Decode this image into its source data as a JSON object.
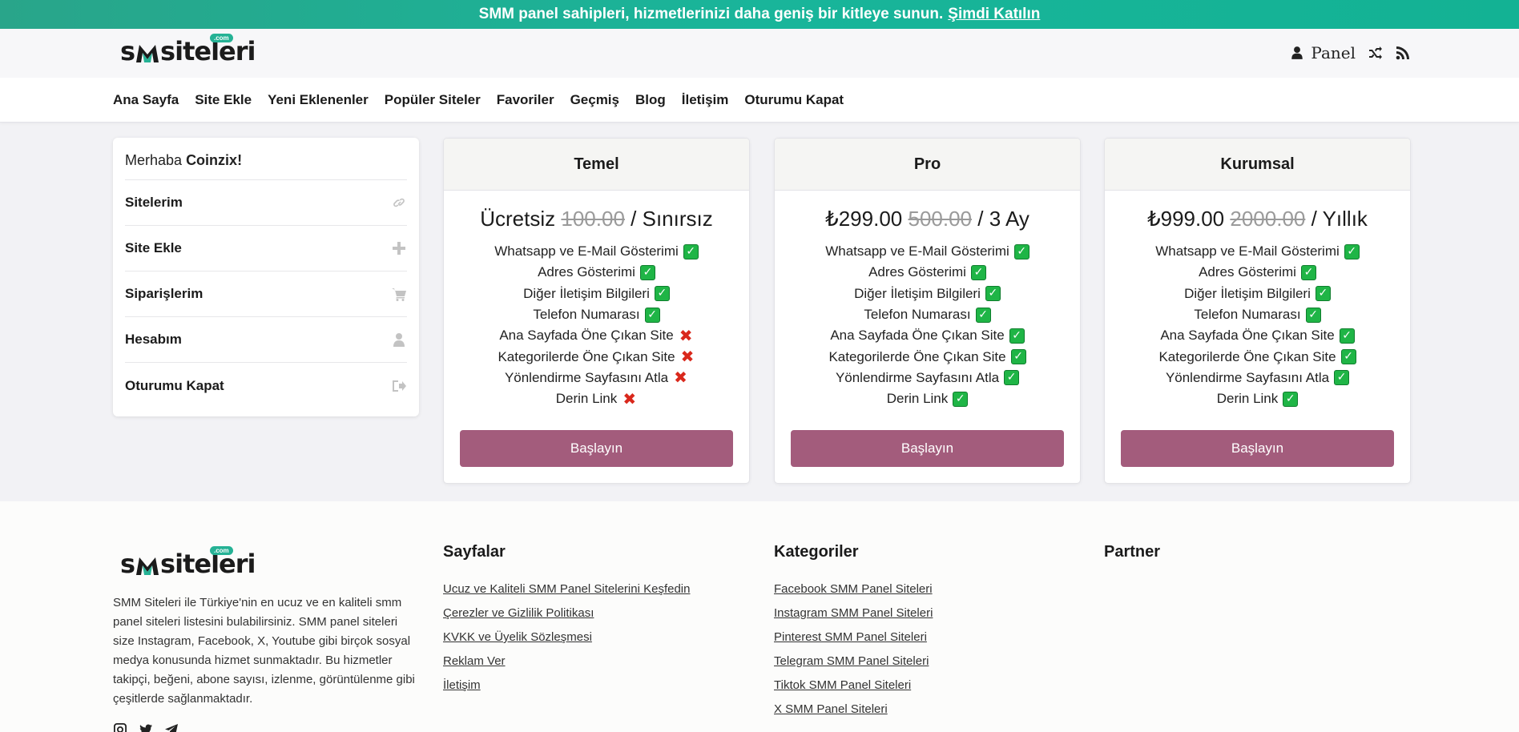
{
  "promo": {
    "text": "SMM panel sahipleri, hizmetlerinizi daha geniş bir kitleye sunun.",
    "link": "Şimdi Katılın"
  },
  "brand": {
    "logo_left": "s",
    "logo_right": "siteleri",
    "logo_tag": ".com"
  },
  "header": {
    "panel_label": "Panel"
  },
  "nav": {
    "items": [
      "Ana Sayfa",
      "Site Ekle",
      "Yeni Eklenenler",
      "Popüler Siteler",
      "Favoriler",
      "Geçmiş",
      "Blog",
      "İletişim",
      "Oturumu Kapat"
    ]
  },
  "sidebar": {
    "greeting": "Merhaba",
    "username": "Coinzix!",
    "items": [
      {
        "label": "Sitelerim",
        "icon": "link-icon"
      },
      {
        "label": "Site Ekle",
        "icon": "plus-icon"
      },
      {
        "label": "Siparişlerim",
        "icon": "cart-icon"
      },
      {
        "label": "Hesabım",
        "icon": "user-icon"
      },
      {
        "label": "Oturumu Kapat",
        "icon": "sign-out-icon"
      }
    ]
  },
  "plans": [
    {
      "name": "Temel",
      "price": "Ücretsiz",
      "old_price": "100.00",
      "period": "/ Sınırsız",
      "button": "Başlayın",
      "features": [
        {
          "label": "Whatsapp ve E-Mail Gösterimi",
          "included": true
        },
        {
          "label": "Adres Gösterimi",
          "included": true
        },
        {
          "label": "Diğer İletişim Bilgileri",
          "included": true
        },
        {
          "label": "Telefon Numarası",
          "included": true
        },
        {
          "label": "Ana Sayfada Öne Çıkan Site",
          "included": false
        },
        {
          "label": "Kategorilerde Öne Çıkan Site",
          "included": false
        },
        {
          "label": "Yönlendirme Sayfasını Atla",
          "included": false
        },
        {
          "label": "Derin Link",
          "included": false
        }
      ]
    },
    {
      "name": "Pro",
      "price": "₺299.00",
      "old_price": "500.00",
      "period": "/ 3 Ay",
      "button": "Başlayın",
      "features": [
        {
          "label": "Whatsapp ve E-Mail Gösterimi",
          "included": true
        },
        {
          "label": "Adres Gösterimi",
          "included": true
        },
        {
          "label": "Diğer İletişim Bilgileri",
          "included": true
        },
        {
          "label": "Telefon Numarası",
          "included": true
        },
        {
          "label": "Ana Sayfada Öne Çıkan Site",
          "included": true
        },
        {
          "label": "Kategorilerde Öne Çıkan Site",
          "included": true
        },
        {
          "label": "Yönlendirme Sayfasını Atla",
          "included": true
        },
        {
          "label": "Derin Link",
          "included": true
        }
      ]
    },
    {
      "name": "Kurumsal",
      "price": "₺999.00",
      "old_price": "2000.00",
      "period": "/ Yıllık",
      "button": "Başlayın",
      "features": [
        {
          "label": "Whatsapp ve E-Mail Gösterimi",
          "included": true
        },
        {
          "label": "Adres Gösterimi",
          "included": true
        },
        {
          "label": "Diğer İletişim Bilgileri",
          "included": true
        },
        {
          "label": "Telefon Numarası",
          "included": true
        },
        {
          "label": "Ana Sayfada Öne Çıkan Site",
          "included": true
        },
        {
          "label": "Kategorilerde Öne Çıkan Site",
          "included": true
        },
        {
          "label": "Yönlendirme Sayfasını Atla",
          "included": true
        },
        {
          "label": "Derin Link",
          "included": true
        }
      ]
    }
  ],
  "footer": {
    "about": "SMM Siteleri ile Türkiye'nin en ucuz ve en kaliteli smm panel siteleri listesini bulabilirsiniz. SMM panel siteleri size Instagram, Facebook, X, Youtube gibi birçok sosyal medya konusunda hizmet sunmaktadır. Bu hizmetler takipçi, beğeni, abone sayısı, izlenme, görüntülenme gibi çeşitlerde sağlanmaktadır.",
    "pages_title": "Sayfalar",
    "pages": [
      "Ucuz ve Kaliteli SMM Panel Sitelerini Keşfedin",
      "Çerezler ve Gizlilik Politikası",
      "KVKK ve Üyelik Sözleşmesi",
      "Reklam Ver",
      "İletişim"
    ],
    "categories_title": "Kategoriler",
    "categories": [
      "Facebook SMM Panel Siteleri",
      "Instagram SMM Panel Siteleri",
      "Pinterest SMM Panel Siteleri",
      "Telegram SMM Panel Siteleri",
      "Tiktok SMM Panel Siteleri",
      "X SMM Panel Siteleri"
    ],
    "partner_title": "Partner"
  },
  "colors": {
    "promo": "#19b59a",
    "button": "#a35c7c",
    "check": "#1fb546",
    "cross": "#d9281c"
  }
}
